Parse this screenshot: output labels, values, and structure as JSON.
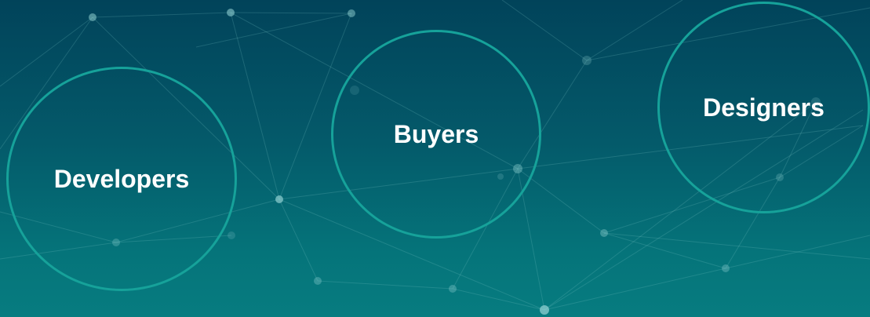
{
  "colors": {
    "background_top": "#01435a",
    "background_bottom": "#077c80",
    "circle_stroke": "#16a29a",
    "label_text": "#ffffff"
  },
  "circles": [
    {
      "label": "Developers"
    },
    {
      "label": "Buyers"
    },
    {
      "label": "Designers"
    }
  ]
}
